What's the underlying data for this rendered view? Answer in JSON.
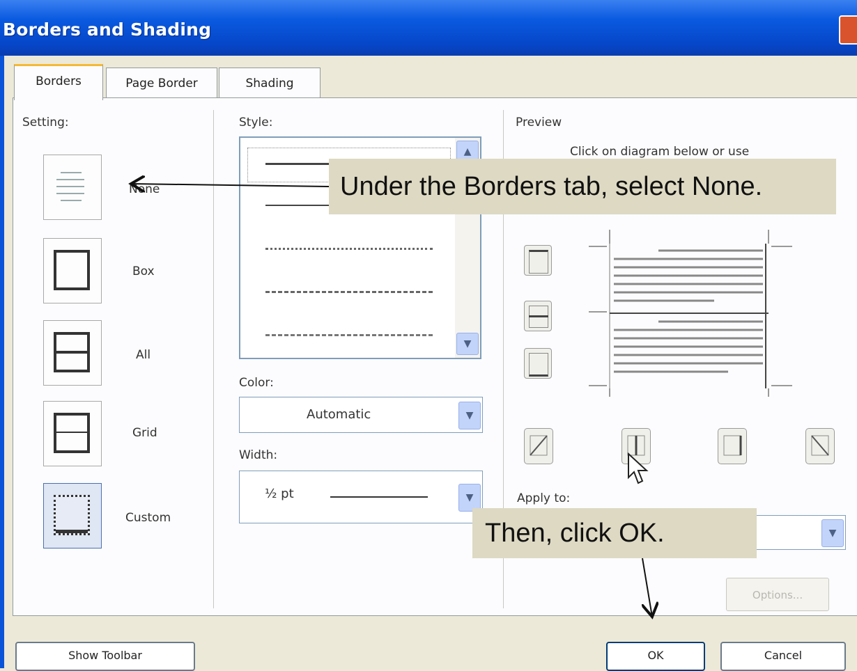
{
  "window": {
    "title": "Borders and Shading"
  },
  "tabs": [
    {
      "label": "Borders",
      "active": true
    },
    {
      "label": "Page Border",
      "active": false
    },
    {
      "label": "Shading",
      "active": false
    }
  ],
  "setting": {
    "label": "Setting:",
    "options": [
      {
        "label": "None"
      },
      {
        "label": "Box"
      },
      {
        "label": "All"
      },
      {
        "label": "Grid"
      },
      {
        "label": "Custom"
      }
    ]
  },
  "style": {
    "label": "Style:"
  },
  "color": {
    "label": "Color:",
    "value": "Automatic"
  },
  "width": {
    "label": "Width:",
    "value": "½ pt"
  },
  "preview": {
    "label": "Preview",
    "hint": "Click on diagram below or use"
  },
  "apply_to": {
    "label": "Apply to:"
  },
  "buttons": {
    "options": "Options...",
    "show_toolbar": "Show Toolbar",
    "ok": "OK",
    "cancel": "Cancel"
  },
  "callouts": {
    "borders_tab": "Under the Borders tab, select None.",
    "click_ok": "Then, click OK."
  },
  "colors": {
    "titlebar": "#0a5ae0",
    "dialog_bg": "#ece9d8",
    "callout_bg": "#ddd9c3",
    "tab_highlight": "#f5b935"
  }
}
